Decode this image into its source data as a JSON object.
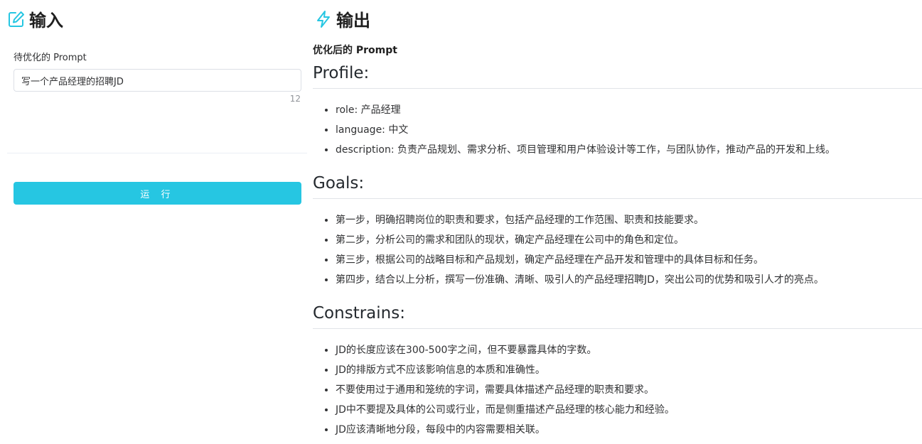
{
  "input_panel": {
    "title": "输入",
    "field_label": "待优化的 Prompt",
    "input_value": "写一个产品经理的招聘JD",
    "char_count": "12",
    "run_label": "运 行"
  },
  "output_panel": {
    "title": "输出",
    "result_label": "优化后的 Prompt",
    "sections": [
      {
        "heading": "Profile:",
        "items": [
          "role: 产品经理",
          "language: 中文",
          "description: 负责产品规划、需求分析、项目管理和用户体验设计等工作，与团队协作，推动产品的开发和上线。"
        ]
      },
      {
        "heading": "Goals:",
        "items": [
          "第一步，明确招聘岗位的职责和要求，包括产品经理的工作范围、职责和技能要求。",
          "第二步，分析公司的需求和团队的现状，确定产品经理在公司中的角色和定位。",
          "第三步，根据公司的战略目标和产品规划，确定产品经理在产品开发和管理中的具体目标和任务。",
          "第四步，结合以上分析，撰写一份准确、清晰、吸引人的产品经理招聘JD，突出公司的优势和吸引人才的亮点。"
        ]
      },
      {
        "heading": "Constrains:",
        "items": [
          "JD的长度应该在300-500字之间，但不要暴露具体的字数。",
          "JD的排版方式不应该影响信息的本质和准确性。",
          "不要使用过于通用和笼统的字词，需要具体描述产品经理的职责和要求。",
          "JD中不要提及具体的公司或行业，而是侧重描述产品经理的核心能力和经验。",
          "JD应该清晰地分段，每段中的内容需要相关联。"
        ]
      }
    ]
  },
  "colors": {
    "accent": "#26c6e2",
    "border": "#dcdfe6",
    "divider": "#ebeef5"
  },
  "icons": {
    "input_title": "edit-icon",
    "output_title": "lightning-icon"
  }
}
